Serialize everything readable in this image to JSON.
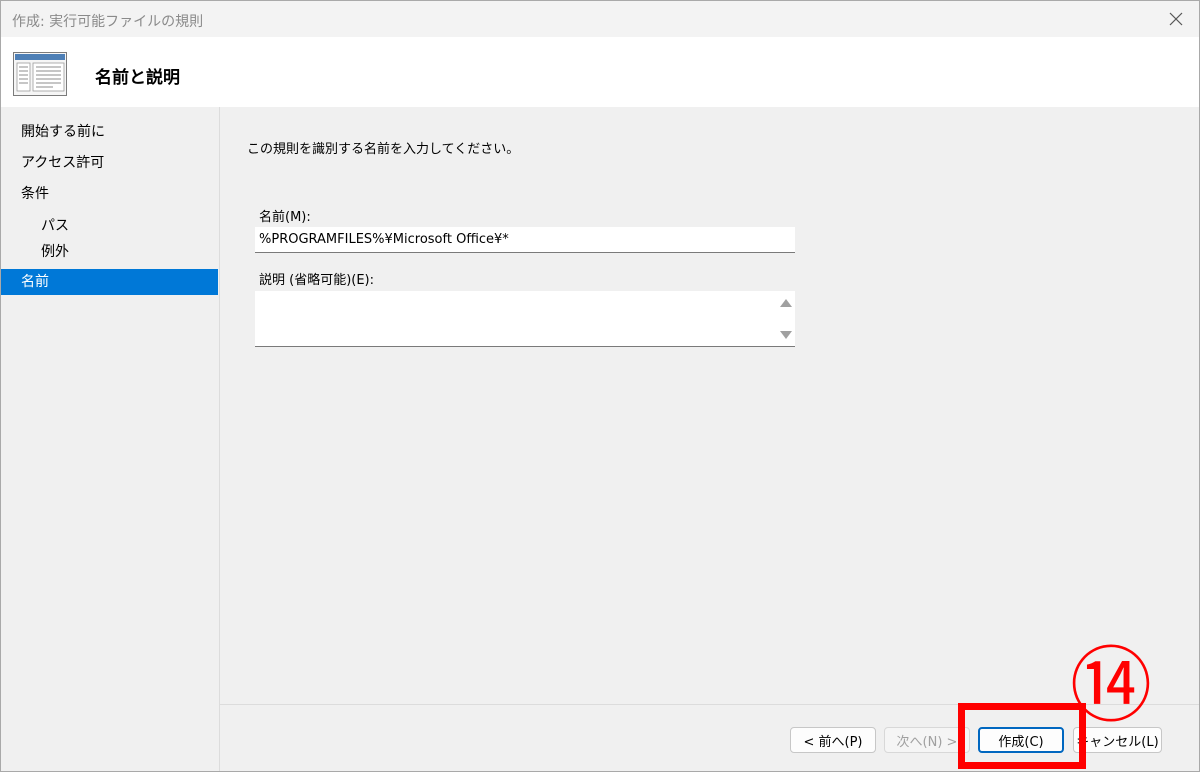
{
  "window": {
    "title": "作成: 実行可能ファイルの規則",
    "close_icon": "close-icon"
  },
  "header": {
    "title": "名前と説明",
    "icon": "wizard-page-icon"
  },
  "sidebar": {
    "items": [
      {
        "label": "開始する前に",
        "selected": false
      },
      {
        "label": "アクセス許可",
        "selected": false
      },
      {
        "label": "条件",
        "selected": false
      },
      {
        "label": "パス",
        "selected": false
      },
      {
        "label": "例外",
        "selected": false
      },
      {
        "label": "名前",
        "selected": true
      }
    ]
  },
  "main": {
    "instruction": "この規則を識別する名前を入力してください。",
    "name_label": "名前(M):",
    "name_value": "%PROGRAMFILES%¥Microsoft Office¥*",
    "description_label": "説明 (省略可能)(E):",
    "description_value": ""
  },
  "buttons": {
    "back": "< 前へ(P)",
    "next": "次へ(N) >",
    "create": "作成(C)",
    "cancel": "キャンセル(L)"
  },
  "annotation": {
    "step_number": "⑭",
    "color": "#ff0000"
  },
  "colors": {
    "selection": "#0078d7",
    "primary_border": "#0067c0"
  }
}
